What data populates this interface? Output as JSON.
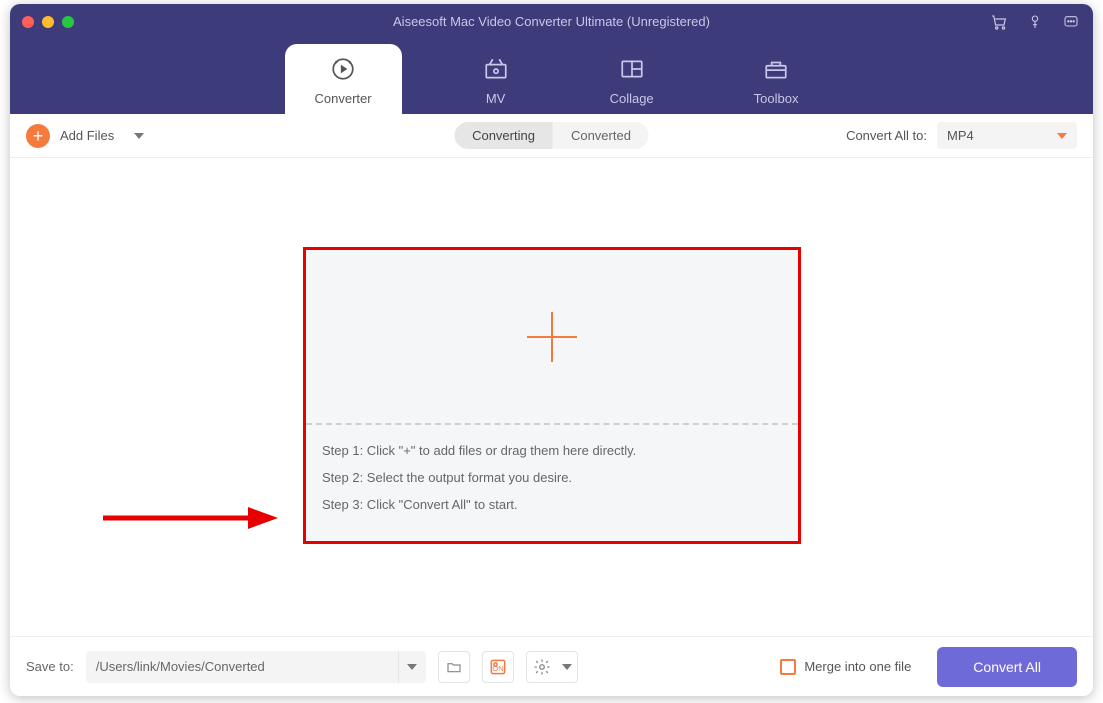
{
  "app_title": "Aiseesoft Mac Video Converter Ultimate (Unregistered)",
  "tabs": {
    "converter": "Converter",
    "mv": "MV",
    "collage": "Collage",
    "toolbox": "Toolbox"
  },
  "toolbar": {
    "add_files": "Add Files",
    "converting": "Converting",
    "converted": "Converted",
    "convert_all_to": "Convert All to:",
    "format_value": "MP4"
  },
  "dropzone": {
    "step1": "Step 1: Click \"+\" to add files or drag them here directly.",
    "step2": "Step 2: Select the output format you desire.",
    "step3": "Step 3: Click \"Convert All\" to start."
  },
  "bottom": {
    "save_to": "Save to:",
    "path": "/Users/link/Movies/Converted",
    "merge": "Merge into one file",
    "convert_all": "Convert All"
  },
  "colors": {
    "header_bg": "#3e3b7b",
    "accent_orange": "#f47a3e",
    "primary_button": "#6e6bd8",
    "annotation_red": "#e60000"
  }
}
